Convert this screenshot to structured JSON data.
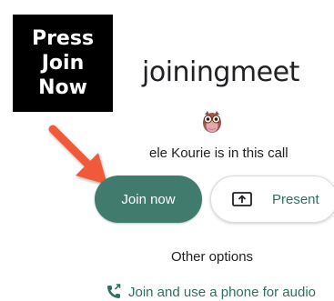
{
  "callout": {
    "line1": "Press",
    "line2": "Join",
    "line3": "Now",
    "arrow_color": "#f05a38"
  },
  "meeting": {
    "title": "joiningmeet",
    "in_call_text": "ele Kourie is in this call"
  },
  "buttons": {
    "join_label": "Join now",
    "present_label": "Present",
    "join_color": "#407b6e"
  },
  "other_options": {
    "label": "Other options",
    "phone_label": "Join and use a phone for audio",
    "phone_icon": "phone-forward-icon",
    "link_color": "#2f6f62"
  },
  "icons": {
    "avatar": "owl-avatar-icon",
    "present": "present-screen-icon"
  }
}
